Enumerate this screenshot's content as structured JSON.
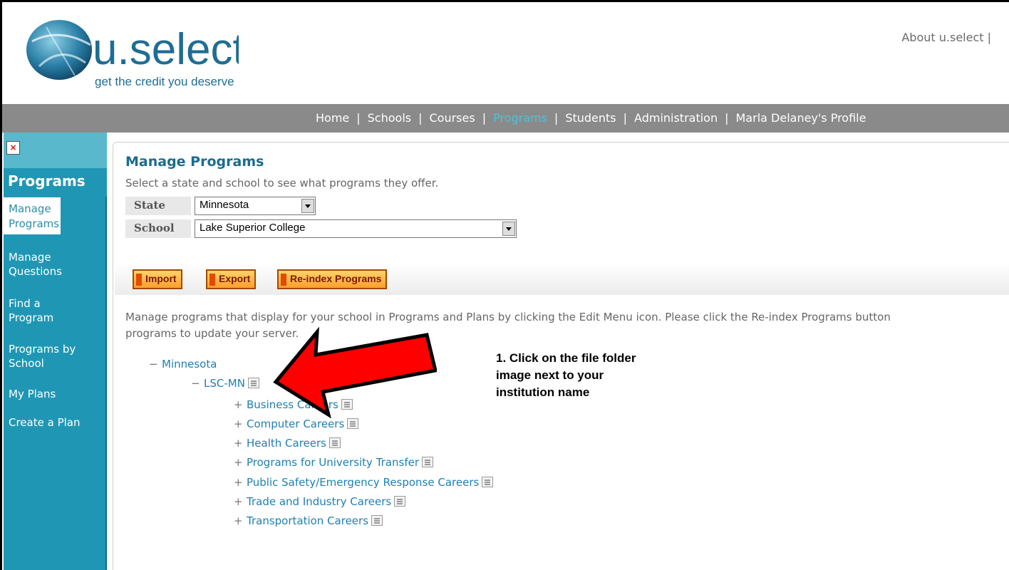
{
  "header": {
    "logo_wordmark": "u.select",
    "logo_tagline": "get the credit you deserve",
    "about_link": "About u.select |"
  },
  "nav": {
    "items": [
      {
        "label": "Home",
        "active": false
      },
      {
        "label": "Schools",
        "active": false
      },
      {
        "label": "Courses",
        "active": false
      },
      {
        "label": "Programs",
        "active": true
      },
      {
        "label": "Students",
        "active": false
      },
      {
        "label": "Administration",
        "active": false
      },
      {
        "label": "Marla Delaney's Profile",
        "active": false
      }
    ],
    "separator": "|"
  },
  "sidebar": {
    "title": "Programs",
    "active_item": "Manage Programs",
    "items": [
      "Manage Questions",
      "Find a Program",
      "Programs by School",
      "My Plans",
      "Create a Plan"
    ]
  },
  "main": {
    "title": "Manage Programs",
    "subtitle": "Select a state and school to see what programs they offer.",
    "state_label": "State",
    "state_value": "Minnesota",
    "school_label": "School",
    "school_value": "Lake Superior College",
    "buttons": {
      "import": "Import",
      "export": "Export",
      "reindex": "Re-index Programs"
    },
    "description": "Manage programs that display for your school in Programs and Plans by clicking the Edit Menu icon.   Please click the Re-index Programs button",
    "description_line2": "programs to update your server."
  },
  "tree": {
    "state": {
      "expander": "−",
      "label": "Minnesota"
    },
    "institution": {
      "expander": "−",
      "label": "LSC-MN"
    },
    "programs": [
      {
        "expander": "+",
        "label": "Business Careers"
      },
      {
        "expander": "+",
        "label": "Computer Careers"
      },
      {
        "expander": "+",
        "label": "Health Careers"
      },
      {
        "expander": "+",
        "label": "Programs for University Transfer"
      },
      {
        "expander": "+",
        "label": "Public Safety/Emergency Response Careers"
      },
      {
        "expander": "+",
        "label": "Trade and Industry Careers"
      },
      {
        "expander": "+",
        "label": "Transportation Careers"
      }
    ]
  },
  "annotation": {
    "line1": "1. Click on the file folder",
    "line2": "image next to your",
    "line3": "institution name"
  },
  "colors": {
    "accent": "#1f97b4",
    "nav_active": "#4cc3da",
    "arrow": "#ff0000",
    "title": "#1d6b8d"
  }
}
